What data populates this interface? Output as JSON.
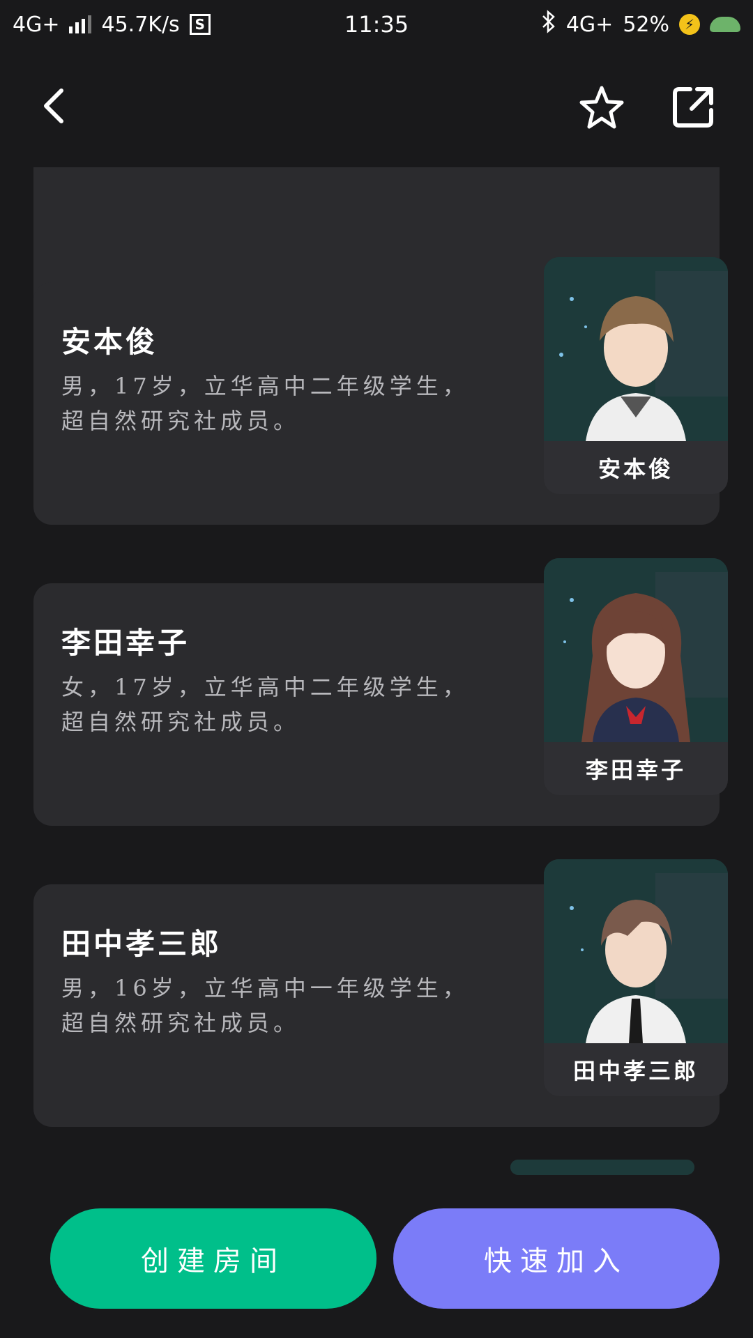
{
  "status_bar": {
    "network": "4G+",
    "speed": "45.7K/s",
    "s_icon": "S",
    "time": "11:35",
    "network_right": "4G+",
    "battery": "52%"
  },
  "header": {
    "back_icon": "chevron-left-icon",
    "favorite_icon": "star-outline-icon",
    "share_icon": "external-link-icon"
  },
  "characters": [
    {
      "name": "安本俊",
      "description": "男，17岁，立华高中二年级学生，超自然研究社成员。",
      "portrait_label": "安本俊",
      "hair_color": "#8a6a4a",
      "outfit_color": "#eeeeee"
    },
    {
      "name": "李田幸子",
      "description": "女，17岁，立华高中二年级学生，超自然研究社成员。",
      "portrait_label": "李田幸子",
      "hair_color": "#6e4336",
      "outfit_color": "#28304e"
    },
    {
      "name": "田中孝三郎",
      "description": "男，16岁，立华高中一年级学生，超自然研究社成员。",
      "portrait_label": "田中孝三郎",
      "hair_color": "#7a5a4c",
      "outfit_color": "#f0f0f0"
    }
  ],
  "actions": {
    "create_room": "创建房间",
    "quick_join": "快速加入"
  },
  "colors": {
    "background": "#19191b",
    "card": "#2b2b2e",
    "create_button": "#00bf8a",
    "join_button": "#7b7cf8"
  }
}
